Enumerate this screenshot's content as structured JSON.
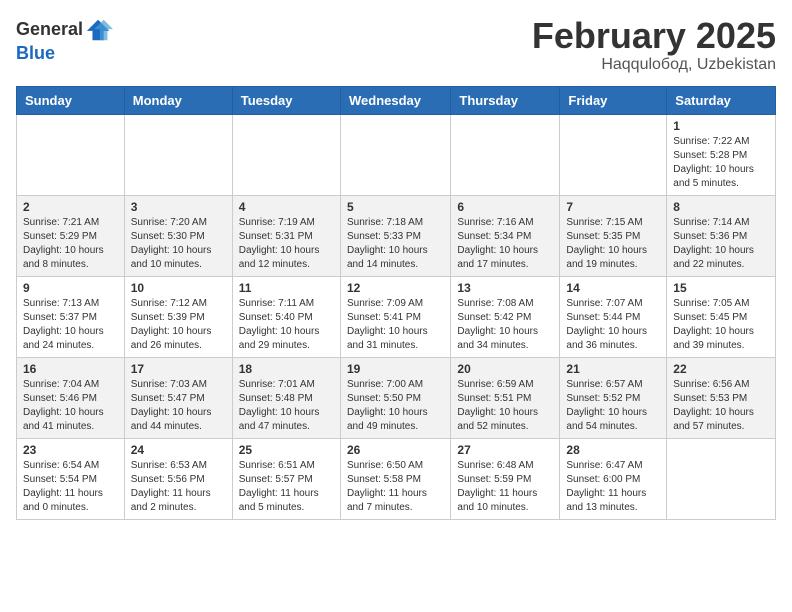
{
  "header": {
    "logo_general": "General",
    "logo_blue": "Blue",
    "month_title": "February 2025",
    "location": "Haqqulобод, Uzbekistan"
  },
  "days_of_week": [
    "Sunday",
    "Monday",
    "Tuesday",
    "Wednesday",
    "Thursday",
    "Friday",
    "Saturday"
  ],
  "weeks": [
    [
      {
        "day": "",
        "info": ""
      },
      {
        "day": "",
        "info": ""
      },
      {
        "day": "",
        "info": ""
      },
      {
        "day": "",
        "info": ""
      },
      {
        "day": "",
        "info": ""
      },
      {
        "day": "",
        "info": ""
      },
      {
        "day": "1",
        "info": "Sunrise: 7:22 AM\nSunset: 5:28 PM\nDaylight: 10 hours\nand 5 minutes."
      }
    ],
    [
      {
        "day": "2",
        "info": "Sunrise: 7:21 AM\nSunset: 5:29 PM\nDaylight: 10 hours\nand 8 minutes."
      },
      {
        "day": "3",
        "info": "Sunrise: 7:20 AM\nSunset: 5:30 PM\nDaylight: 10 hours\nand 10 minutes."
      },
      {
        "day": "4",
        "info": "Sunrise: 7:19 AM\nSunset: 5:31 PM\nDaylight: 10 hours\nand 12 minutes."
      },
      {
        "day": "5",
        "info": "Sunrise: 7:18 AM\nSunset: 5:33 PM\nDaylight: 10 hours\nand 14 minutes."
      },
      {
        "day": "6",
        "info": "Sunrise: 7:16 AM\nSunset: 5:34 PM\nDaylight: 10 hours\nand 17 minutes."
      },
      {
        "day": "7",
        "info": "Sunrise: 7:15 AM\nSunset: 5:35 PM\nDaylight: 10 hours\nand 19 minutes."
      },
      {
        "day": "8",
        "info": "Sunrise: 7:14 AM\nSunset: 5:36 PM\nDaylight: 10 hours\nand 22 minutes."
      }
    ],
    [
      {
        "day": "9",
        "info": "Sunrise: 7:13 AM\nSunset: 5:37 PM\nDaylight: 10 hours\nand 24 minutes."
      },
      {
        "day": "10",
        "info": "Sunrise: 7:12 AM\nSunset: 5:39 PM\nDaylight: 10 hours\nand 26 minutes."
      },
      {
        "day": "11",
        "info": "Sunrise: 7:11 AM\nSunset: 5:40 PM\nDaylight: 10 hours\nand 29 minutes."
      },
      {
        "day": "12",
        "info": "Sunrise: 7:09 AM\nSunset: 5:41 PM\nDaylight: 10 hours\nand 31 minutes."
      },
      {
        "day": "13",
        "info": "Sunrise: 7:08 AM\nSunset: 5:42 PM\nDaylight: 10 hours\nand 34 minutes."
      },
      {
        "day": "14",
        "info": "Sunrise: 7:07 AM\nSunset: 5:44 PM\nDaylight: 10 hours\nand 36 minutes."
      },
      {
        "day": "15",
        "info": "Sunrise: 7:05 AM\nSunset: 5:45 PM\nDaylight: 10 hours\nand 39 minutes."
      }
    ],
    [
      {
        "day": "16",
        "info": "Sunrise: 7:04 AM\nSunset: 5:46 PM\nDaylight: 10 hours\nand 41 minutes."
      },
      {
        "day": "17",
        "info": "Sunrise: 7:03 AM\nSunset: 5:47 PM\nDaylight: 10 hours\nand 44 minutes."
      },
      {
        "day": "18",
        "info": "Sunrise: 7:01 AM\nSunset: 5:48 PM\nDaylight: 10 hours\nand 47 minutes."
      },
      {
        "day": "19",
        "info": "Sunrise: 7:00 AM\nSunset: 5:50 PM\nDaylight: 10 hours\nand 49 minutes."
      },
      {
        "day": "20",
        "info": "Sunrise: 6:59 AM\nSunset: 5:51 PM\nDaylight: 10 hours\nand 52 minutes."
      },
      {
        "day": "21",
        "info": "Sunrise: 6:57 AM\nSunset: 5:52 PM\nDaylight: 10 hours\nand 54 minutes."
      },
      {
        "day": "22",
        "info": "Sunrise: 6:56 AM\nSunset: 5:53 PM\nDaylight: 10 hours\nand 57 minutes."
      }
    ],
    [
      {
        "day": "23",
        "info": "Sunrise: 6:54 AM\nSunset: 5:54 PM\nDaylight: 11 hours\nand 0 minutes."
      },
      {
        "day": "24",
        "info": "Sunrise: 6:53 AM\nSunset: 5:56 PM\nDaylight: 11 hours\nand 2 minutes."
      },
      {
        "day": "25",
        "info": "Sunrise: 6:51 AM\nSunset: 5:57 PM\nDaylight: 11 hours\nand 5 minutes."
      },
      {
        "day": "26",
        "info": "Sunrise: 6:50 AM\nSunset: 5:58 PM\nDaylight: 11 hours\nand 7 minutes."
      },
      {
        "day": "27",
        "info": "Sunrise: 6:48 AM\nSunset: 5:59 PM\nDaylight: 11 hours\nand 10 minutes."
      },
      {
        "day": "28",
        "info": "Sunrise: 6:47 AM\nSunset: 6:00 PM\nDaylight: 11 hours\nand 13 minutes."
      },
      {
        "day": "",
        "info": ""
      }
    ]
  ]
}
